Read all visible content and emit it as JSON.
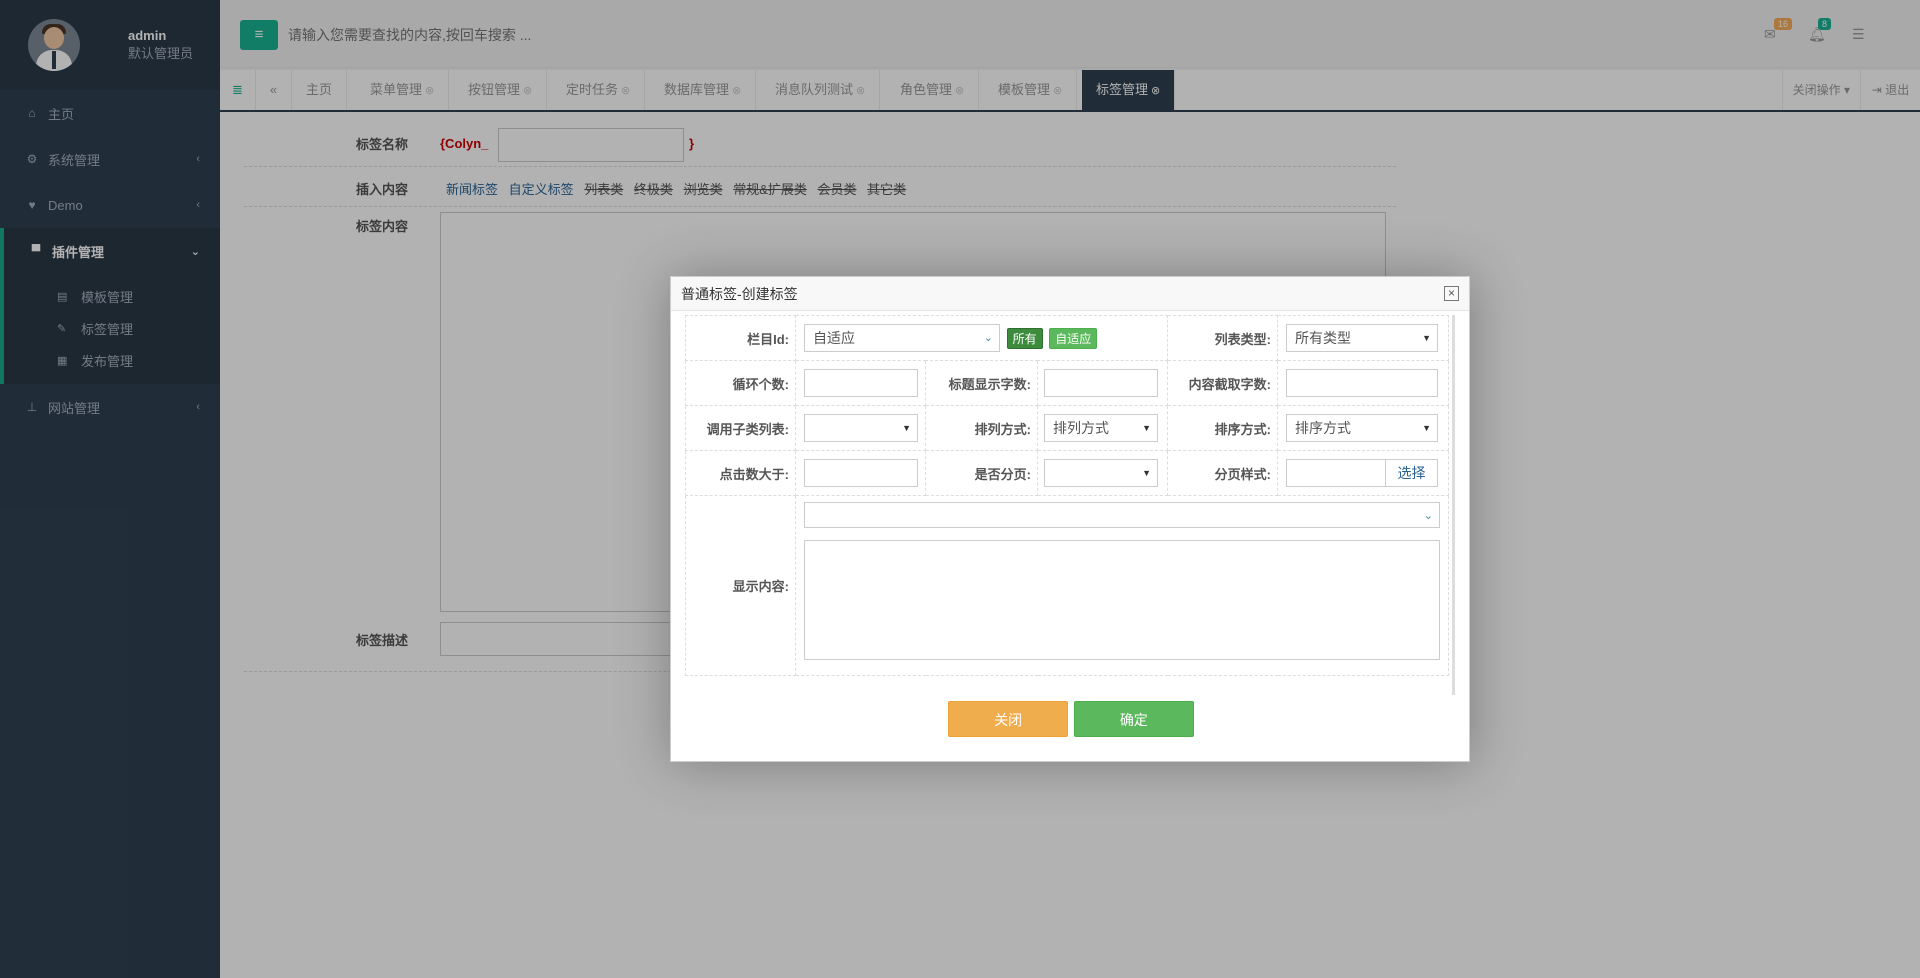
{
  "user": {
    "name": "admin",
    "role": "默认管理员"
  },
  "sidebar": {
    "items": [
      {
        "label": "主页",
        "icon": "home-icon"
      },
      {
        "label": "系统管理",
        "icon": "gear-icon"
      },
      {
        "label": "Demo",
        "icon": "heart-icon"
      },
      {
        "label": "插件管理",
        "icon": "plugin-icon"
      },
      {
        "label": "网站管理",
        "icon": "sitemap-icon"
      }
    ],
    "plugin_submenu": [
      {
        "label": "模板管理",
        "icon": "list-icon"
      },
      {
        "label": "标签管理",
        "icon": "tag-icon"
      },
      {
        "label": "发布管理",
        "icon": "grid-icon"
      }
    ]
  },
  "topbar": {
    "search_placeholder": "请输入您需要查找的内容,按回车搜索 ...",
    "mail_count": "16",
    "bell_count": "8",
    "mail_badge_color": "#f8ac59",
    "bell_badge_color": "#1ab394"
  },
  "tabs": [
    {
      "label": "主页"
    },
    {
      "label": "菜单管理"
    },
    {
      "label": "按钮管理"
    },
    {
      "label": "定时任务"
    },
    {
      "label": "数据库管理"
    },
    {
      "label": "消息队列测试"
    },
    {
      "label": "角色管理"
    },
    {
      "label": "模板管理"
    },
    {
      "label": "标签管理"
    }
  ],
  "tab_actions": {
    "close_ops": "关闭操作",
    "logout": "退出"
  },
  "form": {
    "tag_name_label": "标签名称",
    "tag_prefix": "{Colyn_",
    "tag_suffix": "}",
    "insert_label": "插入内容",
    "insert_links": [
      "新闻标签",
      "自定义标签",
      "列表类",
      "终极类",
      "浏览类",
      "常规&扩展类",
      "会员类",
      "其它类"
    ],
    "content_label": "标签内容",
    "desc_label": "标签描述"
  },
  "modal": {
    "title": "普通标签-创建标签",
    "column_id_label": "栏目Id:",
    "column_id_value": "自适应",
    "btn_all": "所有",
    "btn_adaptive": "自适应",
    "list_type_label": "列表类型:",
    "list_type_value": "所有类型",
    "loop_count_label": "循环个数:",
    "title_chars_label": "标题显示字数:",
    "content_chars_label": "内容截取字数:",
    "sub_list_label": "调用子类列表:",
    "arrange_label": "排列方式:",
    "arrange_value": "排列方式",
    "sort_label": "排序方式:",
    "sort_value": "排序方式",
    "clicks_label": "点击数大于:",
    "paging_label": "是否分页:",
    "page_style_label": "分页样式:",
    "pick_button": "选择",
    "display_label": "显示内容:",
    "close_button": "关闭",
    "confirm_button": "确定"
  }
}
